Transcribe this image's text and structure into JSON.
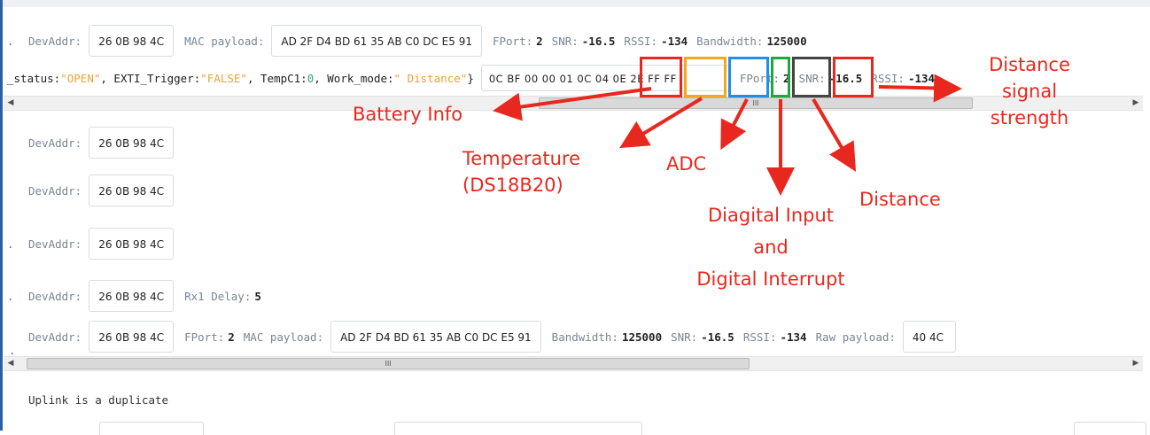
{
  "rows": [
    {
      "items": [
        {
          "type": "dot",
          "text": "."
        },
        {
          "type": "label",
          "text": "DevAddr:"
        },
        {
          "type": "box",
          "text": "26 0B 98 4C"
        },
        {
          "type": "label",
          "text": "MAC payload:"
        },
        {
          "type": "box",
          "text": "AD 2F D4 BD 61 35 AB C0 DC E5 91"
        },
        {
          "type": "label",
          "text": "FPort:"
        },
        {
          "type": "value",
          "text": "2"
        },
        {
          "type": "label",
          "text": "SNR:"
        },
        {
          "type": "value",
          "text": "-16.5"
        },
        {
          "type": "label",
          "text": "RSSI:"
        },
        {
          "type": "value",
          "text": "-134"
        },
        {
          "type": "label",
          "text": "Bandwidth:"
        },
        {
          "type": "value",
          "text": "125000"
        }
      ]
    },
    {
      "items": [
        {
          "type": "label",
          "text": "DevAddr:"
        },
        {
          "type": "box",
          "text": "26 0B 98 4C"
        }
      ]
    },
    {
      "items": [
        {
          "type": "label",
          "text": "DevAddr:"
        },
        {
          "type": "box",
          "text": "26 0B 98 4C"
        }
      ]
    },
    {
      "items": [
        {
          "type": "dot",
          "text": "."
        },
        {
          "type": "label",
          "text": "DevAddr:"
        },
        {
          "type": "box",
          "text": "26 0B 98 4C"
        }
      ]
    },
    {
      "items": [
        {
          "type": "dot",
          "text": "."
        },
        {
          "type": "label",
          "text": "DevAddr:"
        },
        {
          "type": "box",
          "text": "26 0B 98 4C"
        },
        {
          "type": "label",
          "text": "Rx1 Delay:"
        },
        {
          "type": "value",
          "text": "5"
        }
      ]
    },
    {
      "items": [
        {
          "type": "label",
          "text": "DevAddr:"
        },
        {
          "type": "box",
          "text": "26 0B 98 4C"
        },
        {
          "type": "label",
          "text": "FPort:"
        },
        {
          "type": "value",
          "text": "2"
        },
        {
          "type": "label",
          "text": "MAC payload:"
        },
        {
          "type": "box",
          "text": "AD 2F D4 BD 61 35 AB C0 DC E5 91"
        },
        {
          "type": "label",
          "text": "Bandwidth:"
        },
        {
          "type": "value",
          "text": "125000"
        },
        {
          "type": "label",
          "text": "SNR:"
        },
        {
          "type": "value",
          "text": "-16.5"
        },
        {
          "type": "label",
          "text": "RSSI:"
        },
        {
          "type": "value",
          "text": "-134"
        },
        {
          "type": "label",
          "text": "Raw payload:"
        },
        {
          "type": "box",
          "text": "40 4C"
        }
      ]
    }
  ],
  "decoded_row": {
    "prefix": "_status: ",
    "status_value": "\"OPEN\"",
    "exti_label": ", EXTI_Trigger: ",
    "exti_value": "\"FALSE\"",
    "temp_label": ", TempC1: ",
    "temp_value": "0",
    "mode_label": ", Work_mode: ",
    "mode_value": "\" Distance\"",
    "close": " }",
    "payload_bytes": "0C BF 00 00 01 0C 04 0E 2E FF FF",
    "fport_label": "FPort:",
    "fport_value": "2",
    "snr_label": "SNR:",
    "snr_value": "-16.5",
    "rssi_label": "RSSI:",
    "rssi_value": "-134"
  },
  "duplicate_text": "Uplink is a duplicate",
  "scrollbar": {
    "left_arrow": "◀",
    "right_arrow": "▶",
    "grip": "III"
  },
  "annotations": {
    "battery": "Battery Info",
    "temperature_line1": "Temperature",
    "temperature_line2": "(DS18B20)",
    "adc": "ADC",
    "digital_line1": "Diagital Input",
    "digital_line2": "and",
    "digital_line3": "Digital Interrupt",
    "distance": "Distance",
    "signal_line1": "Distance",
    "signal_line2": "signal",
    "signal_line3": "strength"
  },
  "colors": {
    "annotation": "#e8281e",
    "battery_box": "#e8281e",
    "temperature_box": "#f2a91c",
    "adc_box": "#1e90e8",
    "digital_box": "#1fa83a",
    "distance_box": "#444444",
    "signal_box": "#e8281e",
    "string_value": "#e8a23a",
    "number_value": "#3aa776"
  }
}
